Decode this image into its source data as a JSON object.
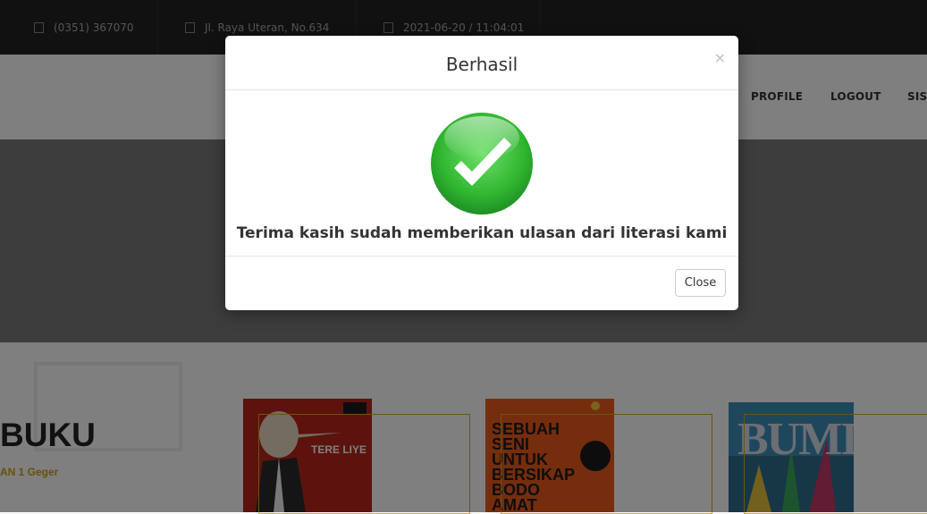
{
  "topbar": {
    "phone": "(0351) 367070",
    "address": "Jl. Raya Uteran, No.634",
    "datetime": "2021-06-20 / 11:04:01"
  },
  "nav": {
    "items": [
      {
        "label": "PROFILE"
      },
      {
        "label": "LOGOUT"
      },
      {
        "label": "SIS"
      }
    ]
  },
  "section": {
    "title": "BUKU",
    "subtitle": "AN 1 Geger"
  },
  "books": [
    {
      "cover_text": "TERE LIYE"
    },
    {
      "cover_text": "SEBUAH SENI UNTUK BERSIKAP BODO AMAT"
    },
    {
      "cover_text": "BUMI"
    }
  ],
  "modal": {
    "title": "Berhasil",
    "close_icon": "×",
    "message": "Terima kasih sudah memberikan ulasan dari literasi kami",
    "close_button": "Close",
    "icon": "success-checkmark-icon"
  },
  "colors": {
    "topbar": "#232323",
    "hero": "#7a7a7a",
    "accent": "#c8a418",
    "success_green": "#3ec43e"
  }
}
